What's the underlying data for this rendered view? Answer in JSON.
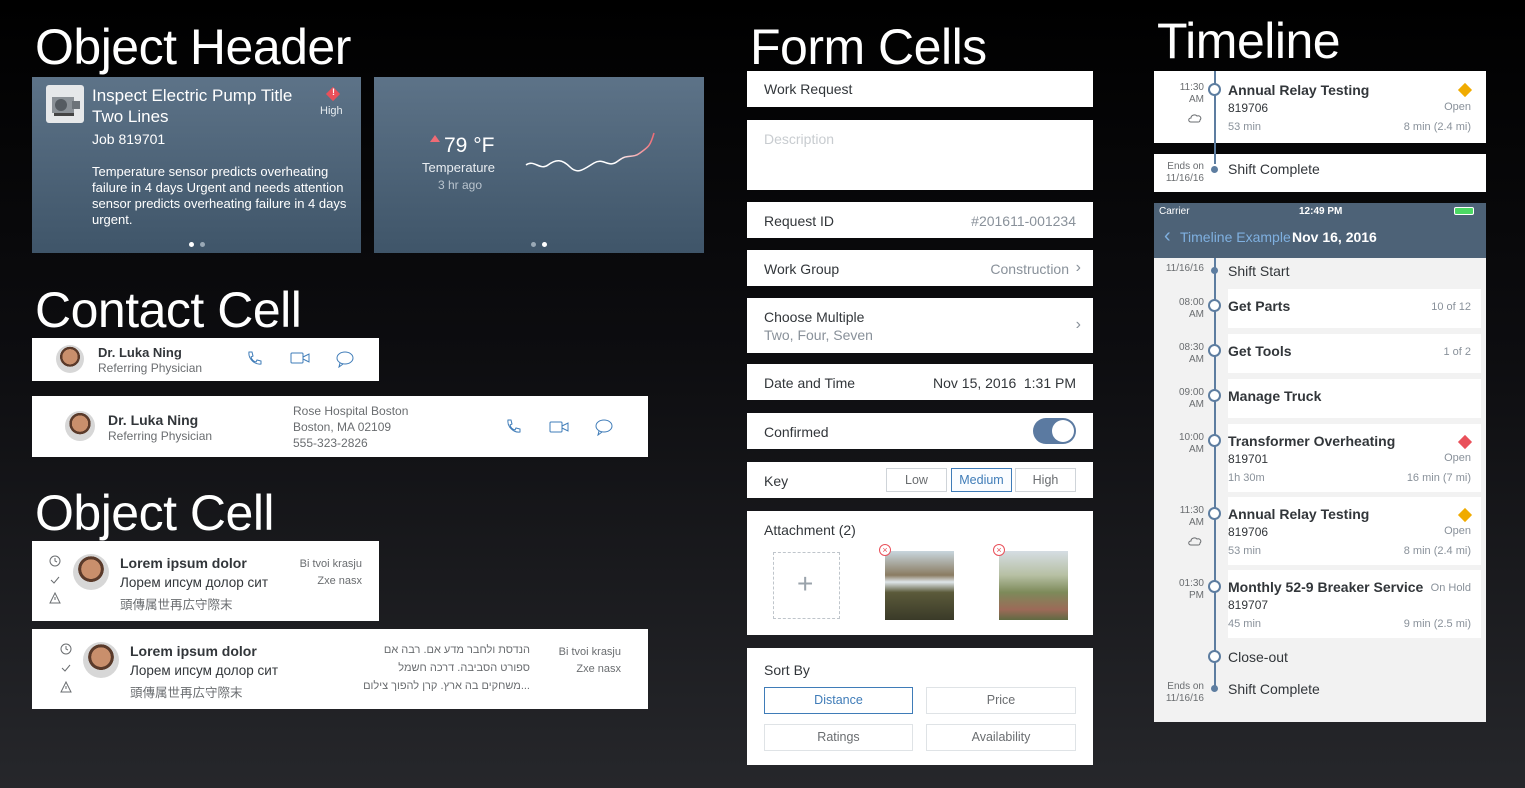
{
  "sections": {
    "object_header": "Object Header",
    "contact_cell": "Contact Cell",
    "object_cell": "Object Cell",
    "form_cells": "Form Cells",
    "timeline": "Timeline"
  },
  "object_header": {
    "title": "Inspect Electric Pump Title Two Lines",
    "subtitle": "Job 819701",
    "priority": "High",
    "description": "Temperature sensor predicts overheating failure in 4 days Urgent and needs attention sensor predicts overheating failure in 4 days urgent.",
    "kpi_value": "79 °F",
    "kpi_label": "Temperature",
    "kpi_time": "3 hr ago"
  },
  "contact": {
    "name": "Dr. Luka Ning",
    "role": "Referring Physician",
    "address1": "Rose Hospital Boston",
    "address2": "Boston, MA 02109",
    "phone": "555-323-2826"
  },
  "object_cell": {
    "title": "Lorem ipsum dolor",
    "line2": "Лорем ипсум долор сит",
    "line3": "頭傳属世再広守際末",
    "attr1": "Bi tvoi krasju",
    "attr2": "Zxe nasx",
    "heb1": "הנדסת ולחבר מדע אם. רבה אם",
    "heb2": "ספורט הסביבה. דרכה חשמל",
    "heb3": "...משחקים בה ארץ. קרן להפוך צילום"
  },
  "form": {
    "work_request": "Work Request",
    "description_placeholder": "Description",
    "request_id_label": "Request ID",
    "request_id_value": "#201611-001234",
    "work_group_label": "Work Group",
    "work_group_value": "Construction",
    "choose_multiple_label": "Choose Multiple",
    "choose_multiple_value": "Two, Four, Seven",
    "date_time_label": "Date and Time",
    "date_value": "Nov 15, 2016",
    "time_value": "1:31 PM",
    "confirmed_label": "Confirmed",
    "key_label": "Key",
    "key_options": [
      "Low",
      "Medium",
      "High"
    ],
    "attachment_label": "Attachment (2)",
    "sort_by_label": "Sort By",
    "sort_options": [
      "Distance",
      "Price",
      "Ratings",
      "Availability"
    ]
  },
  "timeline_top": {
    "time": "11:30",
    "ampm": "AM",
    "title": "Annual Relay Testing",
    "job": "819706",
    "status": "Open",
    "duration": "53 min",
    "distance": "8 min (2.4 mi)",
    "ends_label": "Ends on",
    "ends_date": "11/16/16",
    "shift_complete": "Shift Complete"
  },
  "phone": {
    "carrier": "Carrier",
    "clock": "12:49 PM",
    "back_label": "Timeline Example",
    "nav_title": "Nov 16, 2016",
    "start_date": "11/16/16",
    "shift_start": "Shift Start",
    "items": [
      {
        "time": "08:00",
        "ampm": "AM",
        "title": "Get Parts",
        "right": "10 of 12"
      },
      {
        "time": "08:30",
        "ampm": "AM",
        "title": "Get Tools",
        "right": "1 of 2"
      },
      {
        "time": "09:00",
        "ampm": "AM",
        "title": "Manage Truck",
        "right": ""
      },
      {
        "time": "10:00",
        "ampm": "AM",
        "title": "Transformer Overheating",
        "job": "819701",
        "status": "Open",
        "duration": "1h 30m",
        "distance": "16 min (7 mi)"
      },
      {
        "time": "11:30",
        "ampm": "AM",
        "title": "Annual Relay Testing",
        "job": "819706",
        "status": "Open",
        "duration": "53 min",
        "distance": "8 min (2.4 mi)"
      },
      {
        "time": "01:30",
        "ampm": "PM",
        "title": "Monthly 52-9 Breaker Service",
        "job": "819707",
        "status": "On Hold",
        "duration": "45 min",
        "distance": "9 min (2.5 mi)"
      }
    ],
    "close_out": "Close-out",
    "ends_label": "Ends on",
    "ends_date": "11/16/16",
    "shift_complete": "Shift Complete"
  },
  "colors": {
    "accent": "#3f7cb8",
    "header_bg": "#4e6377",
    "high_priority": "#e9505a",
    "medium_priority": "#f0ab00",
    "timeline": "#5d7da0"
  }
}
